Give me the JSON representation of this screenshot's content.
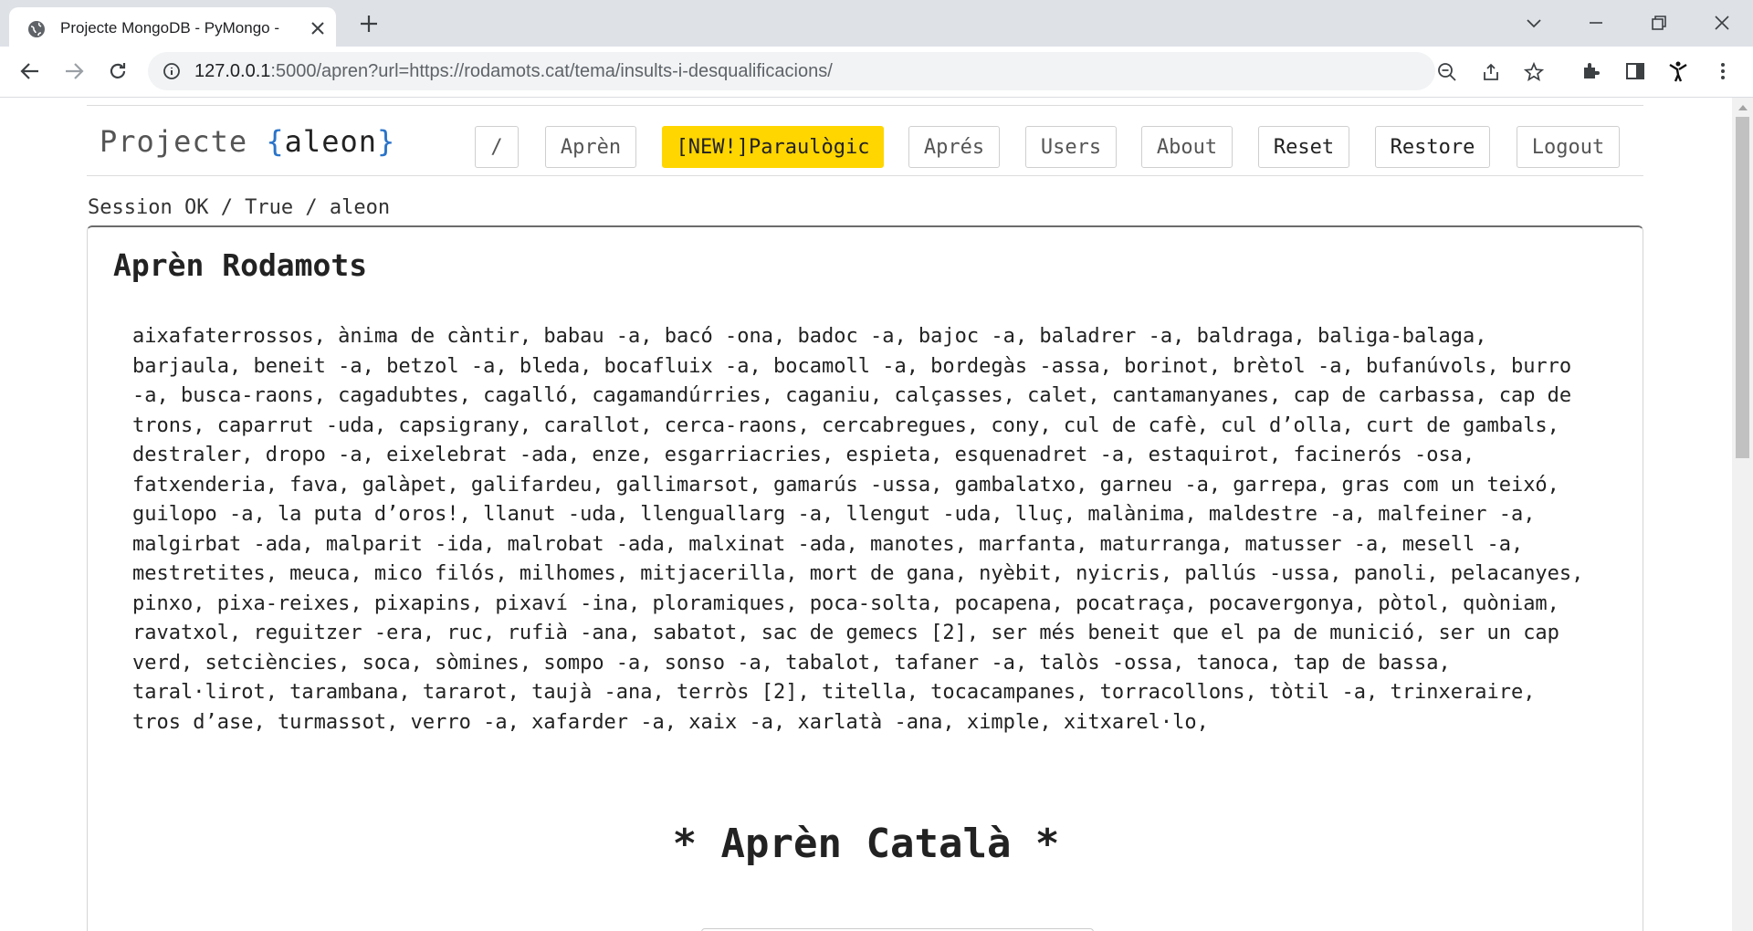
{
  "browser": {
    "tab_title": "Projecte MongoDB - PyMongo -",
    "url_host": "127.0.0.1",
    "url_rest": ":5000/apren?url=https://rodamots.cat/tema/insults-i-desqualificacions/"
  },
  "navbar": {
    "brand_prefix": "Projecte ",
    "brand_open": "{",
    "brand_user": "aleon",
    "brand_close": "}",
    "buttons": {
      "root": "/",
      "apren": "Aprèn",
      "paraulogic": "[NEW!]Paraulògic",
      "apres": "Aprés",
      "users": "Users",
      "about": "About",
      "reset": "Reset",
      "restore": "Restore",
      "logout": "Logout"
    }
  },
  "session_status": "Session OK / True / aleon",
  "card": {
    "heading": "Aprèn Rodamots",
    "words": "aixafaterrossos, ànima de càntir, babau -a, bacó -ona, badoc -a, bajoc -a, baladrer -a, baldraga, baliga-balaga, barjaula, beneit -a, betzol -a, bleda, bocafluix -a, bocamoll -a, bordegàs -assa, borinot, brètol -a, bufanúvols, burro -a, busca-raons, cagadubtes, cagalló, cagamandúrries, caganiu, calçasses, calet, cantamanyanes, cap de carbassa, cap de trons, caparrut -uda, capsigrany, carallot, cerca-raons, cercabregues, cony, cul de cafè, cul d’olla, curt de gambals, destraler, dropo -a, eixelebrat -ada, enze, esgarriacries, espieta, esquenadret -a, estaquirot, facinerós -osa, fatxenderia, fava, galàpet, galifardeu, gallimarsot, gamarús -ussa, gambalatxo, garneu -a, garrepa, gras com un teixó, guilopo -a, la puta d’oros!, llanut -uda, llenguallarg -a, llengut -uda, lluç, malànima, maldestre -a, malfeiner -a, malgirbat -ada, malparit -ida, malrobat -ada, malxinat -ada, manotes, marfanta, maturranga, matusser -a, mesell -a, mestretites, meuca, mico filós, milhomes, mitjacerilla, mort de gana, nyèbit, nyicris, pallús -ussa, panoli, pelacanyes, pinxo, pixa-reixes, pixapins, pixaví -ina, ploramiques, poca-solta, pocapena, pocatraça, pocavergonya, pòtol, quòniam, ravatxol, reguitzer -era, ruc, rufià -ana, sabatot, sac de gemecs [2], ser més beneit que el pa de munició, ser un cap verd, setciències, soca, sòmines, sompo -a, sonso -a, tabalot, tafaner -a, talòs -ossa, tanoca, tap de bassa, taral·lirot, tarambana, tararot, taujà -ana, terròs [2], titella, tocacampanes, torracollons, tòtil -a, trinxeraire, tros d’ase, turmassot, verro -a, xafarder -a, xaix -a, xarlatà -ana, ximple, xitxarel·lo,",
    "big_title": "* Aprèn Català *"
  }
}
